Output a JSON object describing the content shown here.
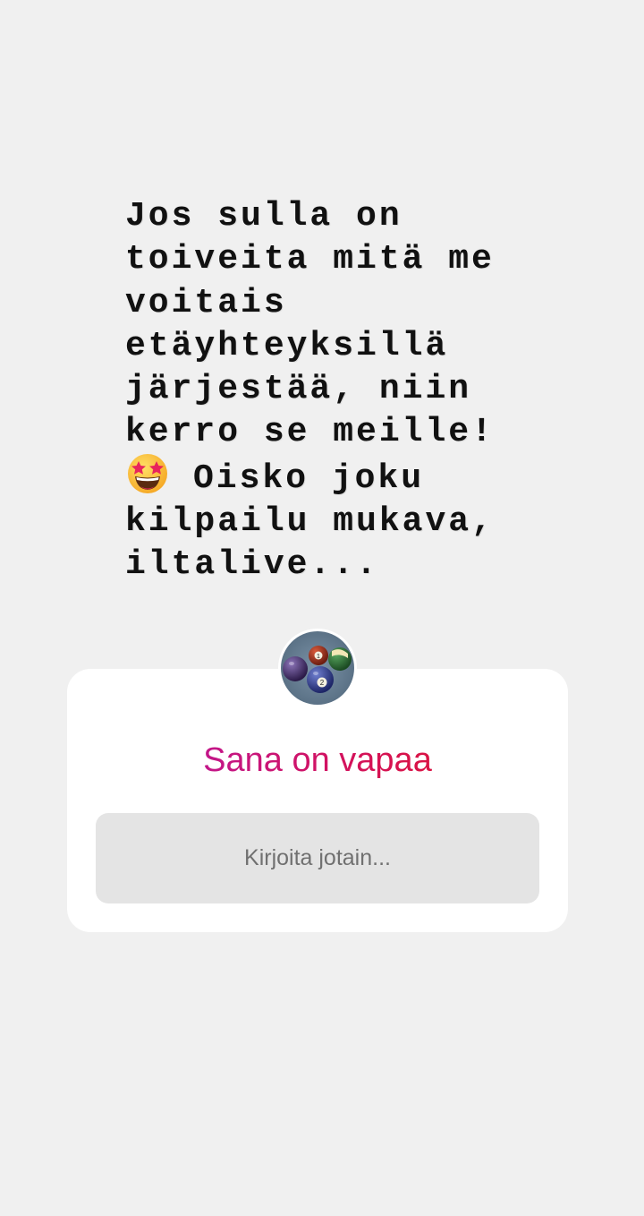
{
  "story": {
    "text_lines": [
      "Jos sulla on",
      "toiveita mitä me",
      "voitais",
      "etäyhteyksillä",
      "järjestää, niin",
      "kerro se meille!",
      "Oisko joku",
      "kilpailu mukava,",
      "iltalive..."
    ],
    "emoji": "star-struck-emoji"
  },
  "question_sticker": {
    "avatar": "billiard-balls-avatar",
    "title": "Sana on vapaa",
    "answer_placeholder": "Kirjoita jotain...",
    "title_gradient": [
      "#b31ab5",
      "#d3125d",
      "#e3151e"
    ],
    "card_color": "#ffffff",
    "field_color": "#e4e4e4"
  },
  "background_color": "#f0f0f0"
}
